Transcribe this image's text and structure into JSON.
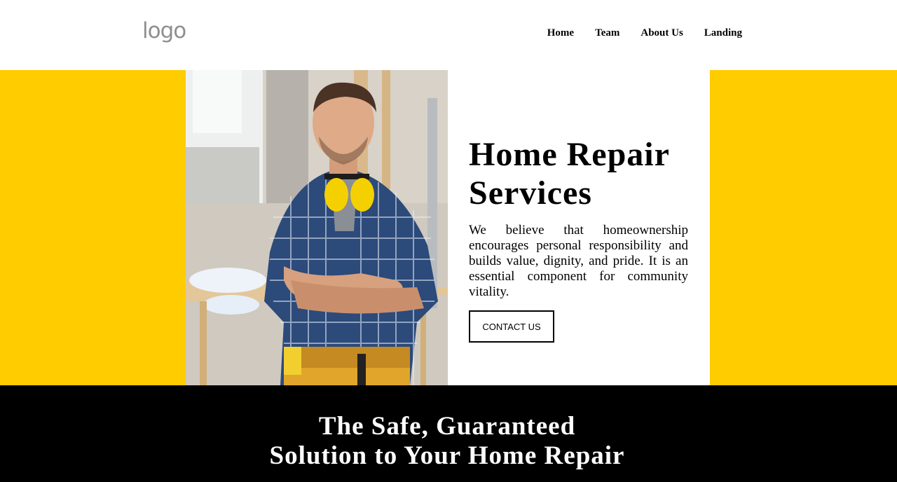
{
  "header": {
    "logo": "logo",
    "nav": [
      "Home",
      "Team",
      "About Us",
      "Landing"
    ]
  },
  "hero": {
    "title": "Home Repair Services",
    "text": "We believe that homeownership encourages personal responsibility and builds value, dignity, and pride. It is an essential component for community vitality.",
    "button": "CONTACT US",
    "image": "construction-worker-photo"
  },
  "band": {
    "title_line1": "The Safe, Guaranteed",
    "title_line2": "Solution to Your Home Repair"
  },
  "colors": {
    "accent": "#ffcc00",
    "band": "#000000",
    "logo": "#8f8f8f"
  }
}
